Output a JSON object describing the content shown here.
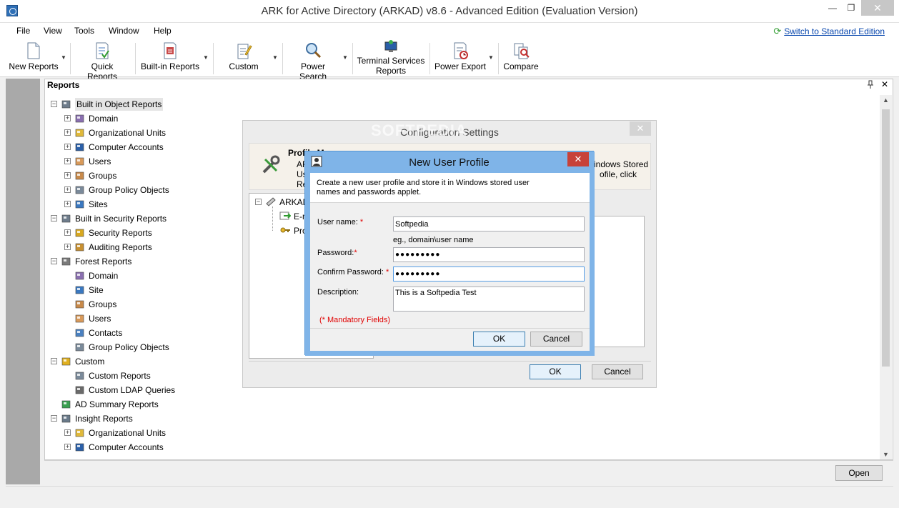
{
  "window": {
    "title": "ARK for Active Directory (ARKAD) v8.6 - Advanced Edition (Evaluation Version)",
    "minimize_glyph": "—",
    "maximize_glyph": "❐",
    "close_glyph": "✕"
  },
  "menu": {
    "items": [
      "File",
      "View",
      "Tools",
      "Window",
      "Help"
    ],
    "switch_label": "Switch to Standard Edition",
    "switch_icon_glyph": "⟳"
  },
  "toolbar": {
    "buttons": [
      {
        "label": "New Reports",
        "icon": "new-report-icon",
        "dropdown": true
      },
      {
        "label": "Quick Reports",
        "icon": "quick-reports-icon",
        "dropdown": false
      },
      {
        "label": "Built-in Reports",
        "icon": "builtin-reports-icon",
        "dropdown": true
      },
      {
        "label": "Custom",
        "icon": "custom-icon",
        "dropdown": true
      },
      {
        "label": "Power Search",
        "icon": "power-search-icon",
        "dropdown": true
      },
      {
        "label_line1": "Terminal Services",
        "label_line2": "Reports",
        "icon": "terminal-services-icon",
        "dropdown": false
      },
      {
        "label": "Power Export",
        "icon": "power-export-icon",
        "dropdown": true
      },
      {
        "label": "Compare",
        "icon": "compare-icon",
        "dropdown": false
      }
    ],
    "dropdown_glyph": "▼"
  },
  "reports_panel": {
    "title": "Reports",
    "pin_glyph": "📌",
    "close_glyph": "✕",
    "scroll_up_glyph": "▲",
    "scroll_down_glyph": "▼",
    "tree": [
      {
        "label": "Built in Object Reports",
        "level": 0,
        "icon": "building-icon",
        "expander": "−"
      },
      {
        "label": "Domain",
        "level": 1,
        "icon": "domain-icon",
        "expander": "+"
      },
      {
        "label": "Organizational Units",
        "level": 1,
        "icon": "ou-icon",
        "expander": "+"
      },
      {
        "label": "Computer Accounts",
        "level": 1,
        "icon": "computer-icon",
        "expander": "+"
      },
      {
        "label": "Users",
        "level": 1,
        "icon": "user-icon",
        "expander": "+"
      },
      {
        "label": "Groups",
        "level": 1,
        "icon": "group-icon",
        "expander": "+"
      },
      {
        "label": "Group Policy Objects",
        "level": 1,
        "icon": "gpo-icon",
        "expander": "+"
      },
      {
        "label": "Sites",
        "level": 1,
        "icon": "sites-icon",
        "expander": "+"
      },
      {
        "label": "Built in Security Reports",
        "level": 0,
        "icon": "building-icon",
        "expander": "−"
      },
      {
        "label": "Security Reports",
        "level": 1,
        "icon": "lock-icon",
        "expander": "+"
      },
      {
        "label": "Auditing Reports",
        "level": 1,
        "icon": "magnifier-icon",
        "expander": "+"
      },
      {
        "label": "Forest Reports",
        "level": 0,
        "icon": "forest-icon",
        "expander": "−"
      },
      {
        "label": "Domain",
        "level": 1,
        "icon": "domain-icon",
        "expander": ""
      },
      {
        "label": "Site",
        "level": 1,
        "icon": "sites-icon",
        "expander": ""
      },
      {
        "label": "Groups",
        "level": 1,
        "icon": "group-icon",
        "expander": ""
      },
      {
        "label": "Users",
        "level": 1,
        "icon": "user-icon",
        "expander": ""
      },
      {
        "label": "Contacts",
        "level": 1,
        "icon": "contact-icon",
        "expander": ""
      },
      {
        "label": "Group Policy Objects",
        "level": 1,
        "icon": "gpo-icon",
        "expander": ""
      },
      {
        "label": "Custom",
        "level": 0,
        "icon": "custom-icon",
        "expander": "−"
      },
      {
        "label": "Custom Reports",
        "level": 1,
        "icon": "report-icon",
        "expander": ""
      },
      {
        "label": "Custom LDAP Queries",
        "level": 1,
        "icon": "ldap-icon",
        "expander": ""
      },
      {
        "label": "AD Summary Reports",
        "level": 0,
        "icon": "summary-icon",
        "expander": ""
      },
      {
        "label": "Insight Reports",
        "level": 0,
        "icon": "insight-icon",
        "expander": "−"
      },
      {
        "label": "Organizational Units",
        "level": 1,
        "icon": "ou-icon",
        "expander": "+"
      },
      {
        "label": "Computer Accounts",
        "level": 1,
        "icon": "computer-icon",
        "expander": "+"
      }
    ],
    "open_label": "Open"
  },
  "config_dialog": {
    "title": "Configuration Settings",
    "close_glyph": "✕",
    "header_title": "Profile Manager",
    "header_l1": "AR",
    "header_l2": "Us",
    "header_l3": "Re",
    "header_r1": "indows Stored",
    "header_r2": "ofile, click",
    "tree_root": "ARKAD",
    "tree_child1": "E-m",
    "tree_child2": "Pro",
    "ok_label": "OK",
    "cancel_label": "Cancel"
  },
  "new_user_profile": {
    "title": "New User Profile",
    "close_glyph": "✕",
    "description_line1": "Create a new user profile and store it in Windows stored user",
    "description_line2": "names and passwords applet.",
    "username_label": "User name:",
    "username_value": "Softpedia",
    "username_hint": "eg., domain\\user name",
    "password_label": "Password:",
    "password_value": "●●●●●●●●●",
    "confirm_label": "Confirm Password:",
    "confirm_value": "●●●●●●●●●",
    "description_label": "Description:",
    "description_value": "This is a Softpedia Test",
    "required_mark": "*",
    "mandatory_note": "(* Mandatory Fields)",
    "ok_label": "OK",
    "cancel_label": "Cancel"
  },
  "watermark": "SOFTPEDIA"
}
